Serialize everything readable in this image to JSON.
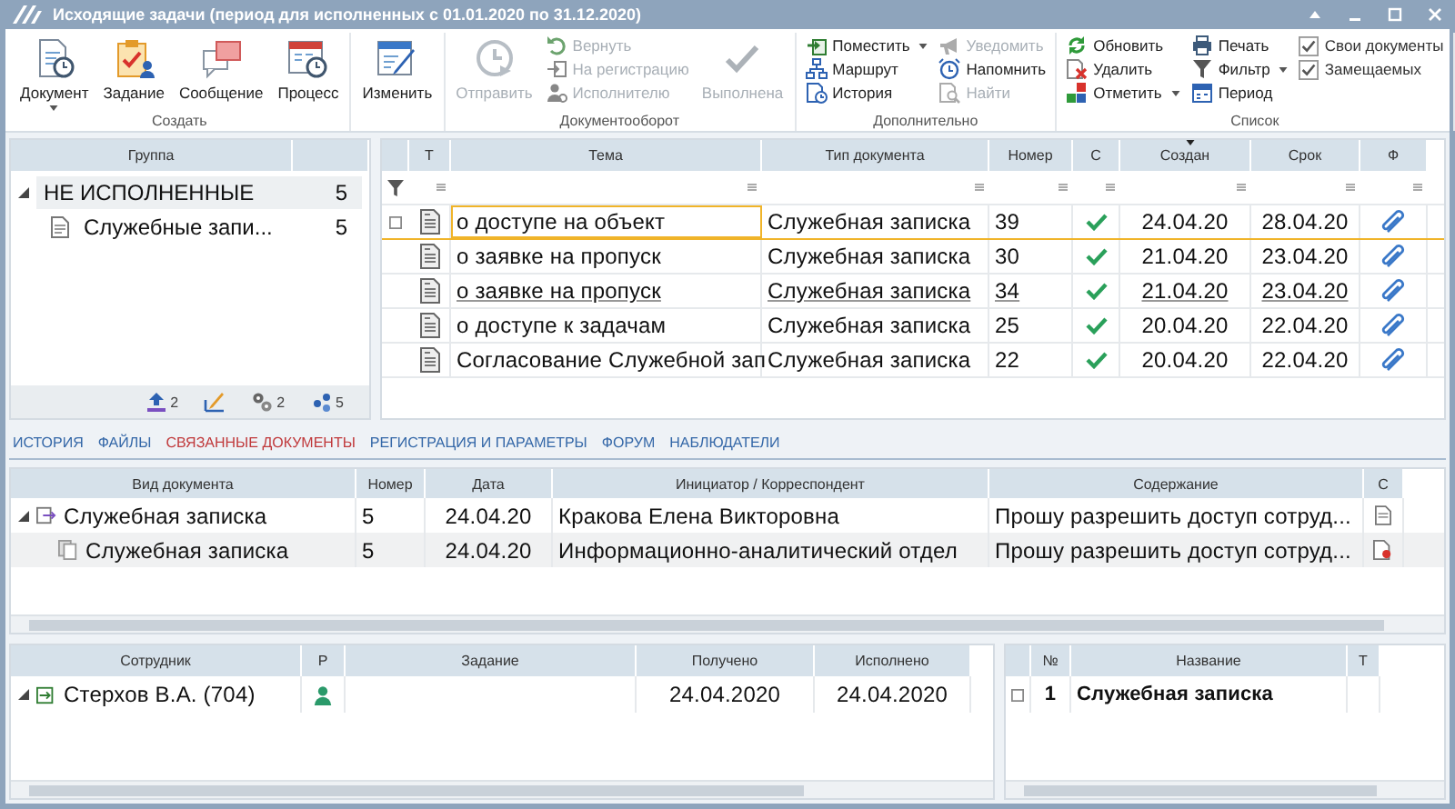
{
  "window": {
    "title": "Исходящие задачи (период для исполненных с 01.01.2020 по 31.12.2020)"
  },
  "ribbon": {
    "groups": [
      {
        "label": "Создать",
        "columns": [
          {
            "kind": "large",
            "label": "Документ",
            "dropdown": true,
            "disabled": false
          },
          {
            "kind": "large",
            "label": "Задание",
            "dropdown": false,
            "disabled": false
          },
          {
            "kind": "large",
            "label": "Сообщение",
            "dropdown": false,
            "disabled": false
          },
          {
            "kind": "large",
            "label": "Процесс",
            "dropdown": false,
            "disabled": false
          }
        ]
      },
      {
        "columns": [
          {
            "kind": "large",
            "label": "Изменить",
            "dropdown": false,
            "disabled": false
          }
        ]
      },
      {
        "label": "Документооборот",
        "columns": [
          {
            "kind": "large",
            "label": "Отправить",
            "dropdown": false,
            "disabled": true
          },
          {
            "kind": "stack",
            "items": [
              {
                "kind": "button",
                "label": "Вернуть",
                "dropdown": false,
                "disabled": true
              },
              {
                "kind": "button",
                "label": "На регистрацию",
                "dropdown": false,
                "disabled": true
              },
              {
                "kind": "button",
                "label": "Исполнителю",
                "dropdown": false,
                "disabled": true
              }
            ]
          },
          {
            "kind": "large",
            "label": "Выполнена",
            "dropdown": false,
            "disabled": true
          }
        ]
      },
      {
        "label": "Дополнительно",
        "columns": [
          {
            "kind": "stack",
            "items": [
              {
                "kind": "button",
                "label": "Поместить",
                "dropdown": true,
                "disabled": false
              },
              {
                "kind": "button",
                "label": "Маршрут",
                "dropdown": false,
                "disabled": false
              },
              {
                "kind": "button",
                "label": "История",
                "dropdown": false,
                "disabled": false
              }
            ]
          },
          {
            "kind": "stack",
            "items": [
              {
                "kind": "button",
                "label": "Уведомить",
                "dropdown": false,
                "disabled": true
              },
              {
                "kind": "button",
                "label": "Напомнить",
                "dropdown": false,
                "disabled": false
              },
              {
                "kind": "button",
                "label": "Найти",
                "dropdown": false,
                "disabled": true
              }
            ]
          }
        ]
      },
      {
        "label": "Список",
        "columns": [
          {
            "kind": "stack",
            "items": [
              {
                "kind": "button",
                "label": "Обновить",
                "dropdown": false,
                "disabled": false
              },
              {
                "kind": "button",
                "label": "Удалить",
                "dropdown": false,
                "disabled": false
              },
              {
                "kind": "button",
                "label": "Отметить",
                "dropdown": true,
                "disabled": false
              }
            ]
          },
          {
            "kind": "stack",
            "items": [
              {
                "kind": "button",
                "label": "Печать",
                "dropdown": false,
                "disabled": false
              },
              {
                "kind": "button",
                "label": "Фильтр",
                "dropdown": true,
                "disabled": false
              },
              {
                "kind": "button",
                "label": "Период",
                "dropdown": false,
                "disabled": false
              }
            ]
          },
          {
            "kind": "stack",
            "items": [
              {
                "kind": "checkbox",
                "label": "Свои документы",
                "checked": true
              },
              {
                "kind": "checkbox",
                "label": "Замещаемых",
                "checked": true
              }
            ]
          }
        ]
      }
    ]
  },
  "group_panel": {
    "header": "Группа",
    "rows": [
      {
        "label": "НЕ ИСПОЛНЕННЫЕ",
        "count": "5",
        "expanded": true,
        "selected": true,
        "children": [
          {
            "label": "Служебные запи...",
            "count": "5",
            "selected": false
          }
        ]
      }
    ],
    "footer": [
      {
        "kind": "counted",
        "count": "2"
      },
      {
        "kind": "plain"
      },
      {
        "kind": "counted",
        "count": "2"
      },
      {
        "kind": "counted",
        "count": "5"
      }
    ]
  },
  "task_table": {
    "columns": [
      {
        "label": "Т",
        "sorted": false
      },
      {
        "label": "Тема",
        "sorted": false
      },
      {
        "label": "Тип документа",
        "sorted": false
      },
      {
        "label": "Номер",
        "sorted": false
      },
      {
        "label": "С",
        "sorted": false
      },
      {
        "label": "Создан",
        "sorted": true
      },
      {
        "label": "Срок",
        "sorted": false
      },
      {
        "label": "Ф",
        "sorted": false
      }
    ],
    "rows": [
      {
        "subject": "о доступе на объект",
        "doc_type": "Служебная записка",
        "number": "39",
        "completed": true,
        "created": "24.04.20",
        "due": "28.04.20",
        "attachment": true,
        "selected": true,
        "hovered": false
      },
      {
        "subject": "о заявке на пропуск",
        "doc_type": "Служебная записка",
        "number": "30",
        "completed": true,
        "created": "21.04.20",
        "due": "23.04.20",
        "attachment": true,
        "selected": false,
        "hovered": false
      },
      {
        "subject": "о заявке на пропуск",
        "doc_type": "Служебная записка",
        "number": "34",
        "completed": true,
        "created": "21.04.20",
        "due": "23.04.20",
        "attachment": true,
        "selected": false,
        "hovered": true
      },
      {
        "subject": "о доступе к задачам",
        "doc_type": "Служебная записка",
        "number": "25",
        "completed": true,
        "created": "20.04.20",
        "due": "22.04.20",
        "attachment": true,
        "selected": false,
        "hovered": false
      },
      {
        "subject": "Согласование Служебной зап",
        "doc_type": "Служебная записка",
        "number": "22",
        "completed": true,
        "created": "20.04.20",
        "due": "22.04.20",
        "attachment": true,
        "selected": false,
        "hovered": false
      }
    ]
  },
  "tabs": [
    {
      "label": "ИСТОРИЯ",
      "selected": false
    },
    {
      "label": "ФАЙЛЫ",
      "selected": false
    },
    {
      "label": "СВЯЗАННЫЕ ДОКУМЕНТЫ",
      "selected": true
    },
    {
      "label": "РЕГИСТРАЦИЯ И ПАРАМЕТРЫ",
      "selected": false
    },
    {
      "label": "ФОРУМ",
      "selected": false
    },
    {
      "label": "НАБЛЮДАТЕЛИ",
      "selected": false
    }
  ],
  "related_documents": {
    "columns": [
      "Вид документа",
      "Номер",
      "Дата",
      "Инициатор / Корреспондент",
      "Содержание",
      "С"
    ],
    "rows": [
      {
        "doc_type": "Служебная записка",
        "number": "5",
        "date": "24.04.20",
        "initiator": "Кракова Елена Викторовна",
        "content": "Прошу разрешить доступ сотруд...",
        "expanded": true,
        "selected": false,
        "children": [
          {
            "doc_type": "Служебная записка",
            "number": "5",
            "date": "24.04.20",
            "initiator": "Информационно-аналитический отдел",
            "content": "Прошу разрешить доступ сотруд...",
            "selected": true
          }
        ]
      }
    ]
  },
  "performers": {
    "columns": [
      "Сотрудник",
      "Р",
      "Задание",
      "Получено",
      "Исполнено"
    ],
    "rows": [
      {
        "name": "Стерхов В.А. (704)",
        "expanded": true,
        "received": "24.04.2020",
        "done": "24.04.2020"
      }
    ]
  },
  "attachments": {
    "columns": [
      "№",
      "Название",
      "Т"
    ],
    "rows": [
      {
        "number": "1",
        "name": "Служебная записка",
        "checked": false
      }
    ]
  }
}
